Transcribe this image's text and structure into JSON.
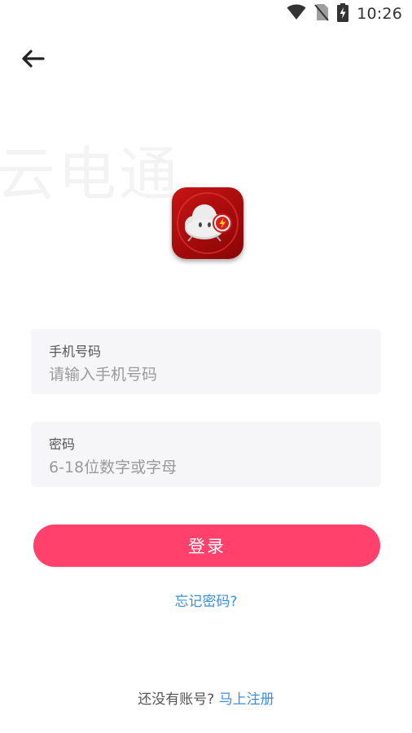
{
  "status_bar": {
    "time": "10:26",
    "icons": [
      "wifi-icon",
      "no-sim-icon",
      "battery-charging-icon"
    ]
  },
  "nav": {
    "back_icon": "arrow-left-icon"
  },
  "watermark": {
    "text": "云电通"
  },
  "logo": {
    "icon": "cloud-lightning-icon"
  },
  "form": {
    "phone": {
      "label": "手机号码",
      "value": "",
      "placeholder": "请输入手机号码"
    },
    "password": {
      "label": "密码",
      "value": "",
      "placeholder": "6-18位数字或字母"
    },
    "login_label": "登录",
    "forgot_label": "忘记密码?"
  },
  "footer": {
    "prompt": "还没有账号?",
    "register_label": "马上注册"
  },
  "colors": {
    "accent": "#ff416b",
    "link": "#3a8ee6",
    "field_bg": "#f6f6f9",
    "logo_red": "#c81414"
  }
}
